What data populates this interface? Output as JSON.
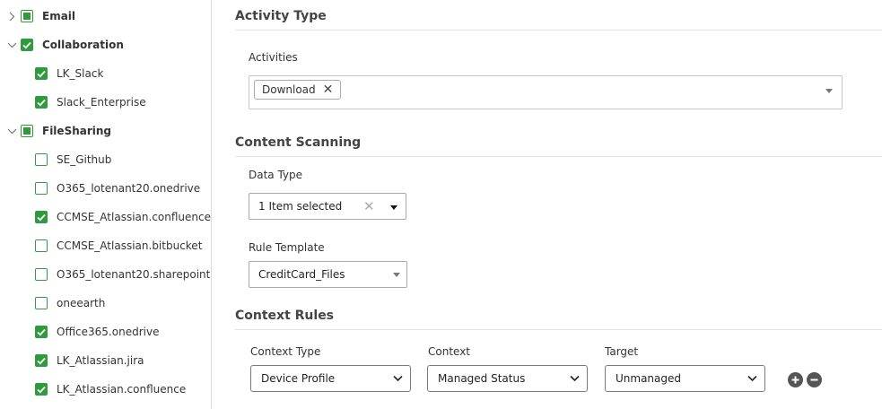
{
  "tree": {
    "items": [
      {
        "label": "Email",
        "level": 0,
        "expanded": false,
        "state": "partial",
        "bold": true
      },
      {
        "label": "Collaboration",
        "level": 0,
        "expanded": true,
        "state": "checked",
        "bold": true
      },
      {
        "label": "LK_Slack",
        "level": 1,
        "state": "checked"
      },
      {
        "label": "Slack_Enterprise",
        "level": 1,
        "state": "checked"
      },
      {
        "label": "FileSharing",
        "level": 0,
        "expanded": true,
        "state": "partial",
        "bold": true
      },
      {
        "label": "SE_Github",
        "level": 1,
        "state": "unchecked"
      },
      {
        "label": "O365_lotenant20.onedrive",
        "level": 1,
        "state": "unchecked"
      },
      {
        "label": "CCMSE_Atlassian.confluence",
        "level": 1,
        "state": "checked"
      },
      {
        "label": "CCMSE_Atlassian.bitbucket",
        "level": 1,
        "state": "unchecked"
      },
      {
        "label": "O365_lotenant20.sharepoint",
        "level": 1,
        "state": "unchecked"
      },
      {
        "label": "oneearth",
        "level": 1,
        "state": "unchecked"
      },
      {
        "label": "Office365.onedrive",
        "level": 1,
        "state": "checked"
      },
      {
        "label": "LK_Atlassian.jira",
        "level": 1,
        "state": "checked"
      },
      {
        "label": "LK_Atlassian.confluence",
        "level": 1,
        "state": "checked"
      }
    ]
  },
  "activity": {
    "title": "Activity Type",
    "activities_label": "Activities",
    "tags": [
      "Download"
    ]
  },
  "content": {
    "title": "Content Scanning",
    "data_type_label": "Data Type",
    "data_type_value": "1 Item selected",
    "rule_template_label": "Rule Template",
    "rule_template_value": "CreditCard_Files"
  },
  "context": {
    "title": "Context Rules",
    "context_type_label": "Context Type",
    "context_label": "Context",
    "target_label": "Target",
    "context_type_value": "Device Profile",
    "context_value": "Managed Status",
    "target_value": "Unmanaged"
  },
  "colors": {
    "check": "#2e9b3e"
  }
}
